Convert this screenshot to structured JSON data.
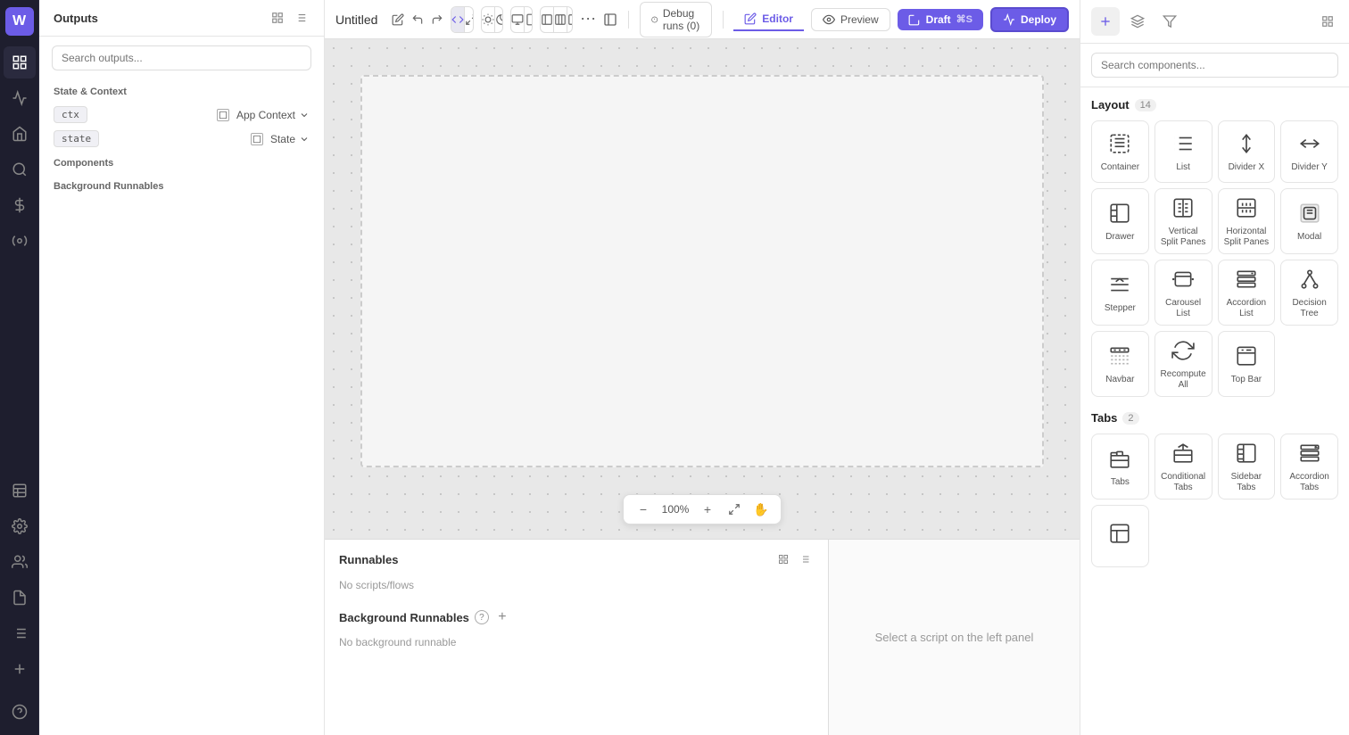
{
  "app": {
    "title": "Untitled",
    "zoom": "100%"
  },
  "topbar": {
    "debug_label": "Debug runs (0)",
    "editor_label": "Editor",
    "preview_label": "Preview",
    "draft_label": "Draft",
    "draft_shortcut": "⌘S",
    "deploy_label": "Deploy"
  },
  "left_panel": {
    "title": "Outputs",
    "search_placeholder": "Search outputs...",
    "state_context_label": "State & Context",
    "ctx_tag": "ctx",
    "app_context_label": "App Context",
    "state_tag": "state",
    "state_label": "State",
    "components_label": "Components",
    "background_runnables_label": "Background Runnables"
  },
  "bottom_panel": {
    "runnables_title": "Runnables",
    "no_scripts_text": "No scripts/flows",
    "bg_runnables_title": "Background Runnables",
    "no_bg_runnable_text": "No background runnable",
    "script_select_text": "Select a script on the left panel"
  },
  "right_panel": {
    "search_placeholder": "Search components...",
    "layout_title": "Layout",
    "layout_count": "14",
    "tabs_title": "Tabs",
    "tabs_count": "2",
    "layout_components": [
      {
        "id": "container",
        "label": "Container",
        "icon": "container"
      },
      {
        "id": "list",
        "label": "List",
        "icon": "list"
      },
      {
        "id": "divider-x",
        "label": "Divider X",
        "icon": "divider-x"
      },
      {
        "id": "divider-y",
        "label": "Divider Y",
        "icon": "divider-y"
      },
      {
        "id": "drawer",
        "label": "Drawer",
        "icon": "drawer"
      },
      {
        "id": "vertical-split",
        "label": "Vertical Split Panes",
        "icon": "vertical-split"
      },
      {
        "id": "horizontal-split",
        "label": "Horizontal Split Panes",
        "icon": "horizontal-split"
      },
      {
        "id": "modal",
        "label": "Modal",
        "icon": "modal"
      },
      {
        "id": "stepper",
        "label": "Stepper",
        "icon": "stepper"
      },
      {
        "id": "carousel-list",
        "label": "Carousel List",
        "icon": "carousel-list"
      },
      {
        "id": "accordion-list",
        "label": "Accordion List",
        "icon": "accordion-list"
      },
      {
        "id": "decision-tree",
        "label": "Decision Tree",
        "icon": "decision-tree"
      },
      {
        "id": "navbar",
        "label": "Navbar",
        "icon": "navbar"
      },
      {
        "id": "recompute-all",
        "label": "Recompute All",
        "icon": "recompute-all"
      },
      {
        "id": "top-bar",
        "label": "Top Bar",
        "icon": "top-bar"
      }
    ],
    "tabs_components": [
      {
        "id": "tabs",
        "label": "Tabs",
        "icon": "tabs"
      },
      {
        "id": "conditional-tabs",
        "label": "Conditional Tabs",
        "icon": "conditional-tabs"
      },
      {
        "id": "sidebar-tabs",
        "label": "Sidebar Tabs",
        "icon": "sidebar-tabs"
      },
      {
        "id": "accordion-tabs",
        "label": "Accordion Tabs",
        "icon": "accordion-tabs"
      },
      {
        "id": "more-tabs",
        "label": "",
        "icon": "more-tabs"
      }
    ]
  }
}
